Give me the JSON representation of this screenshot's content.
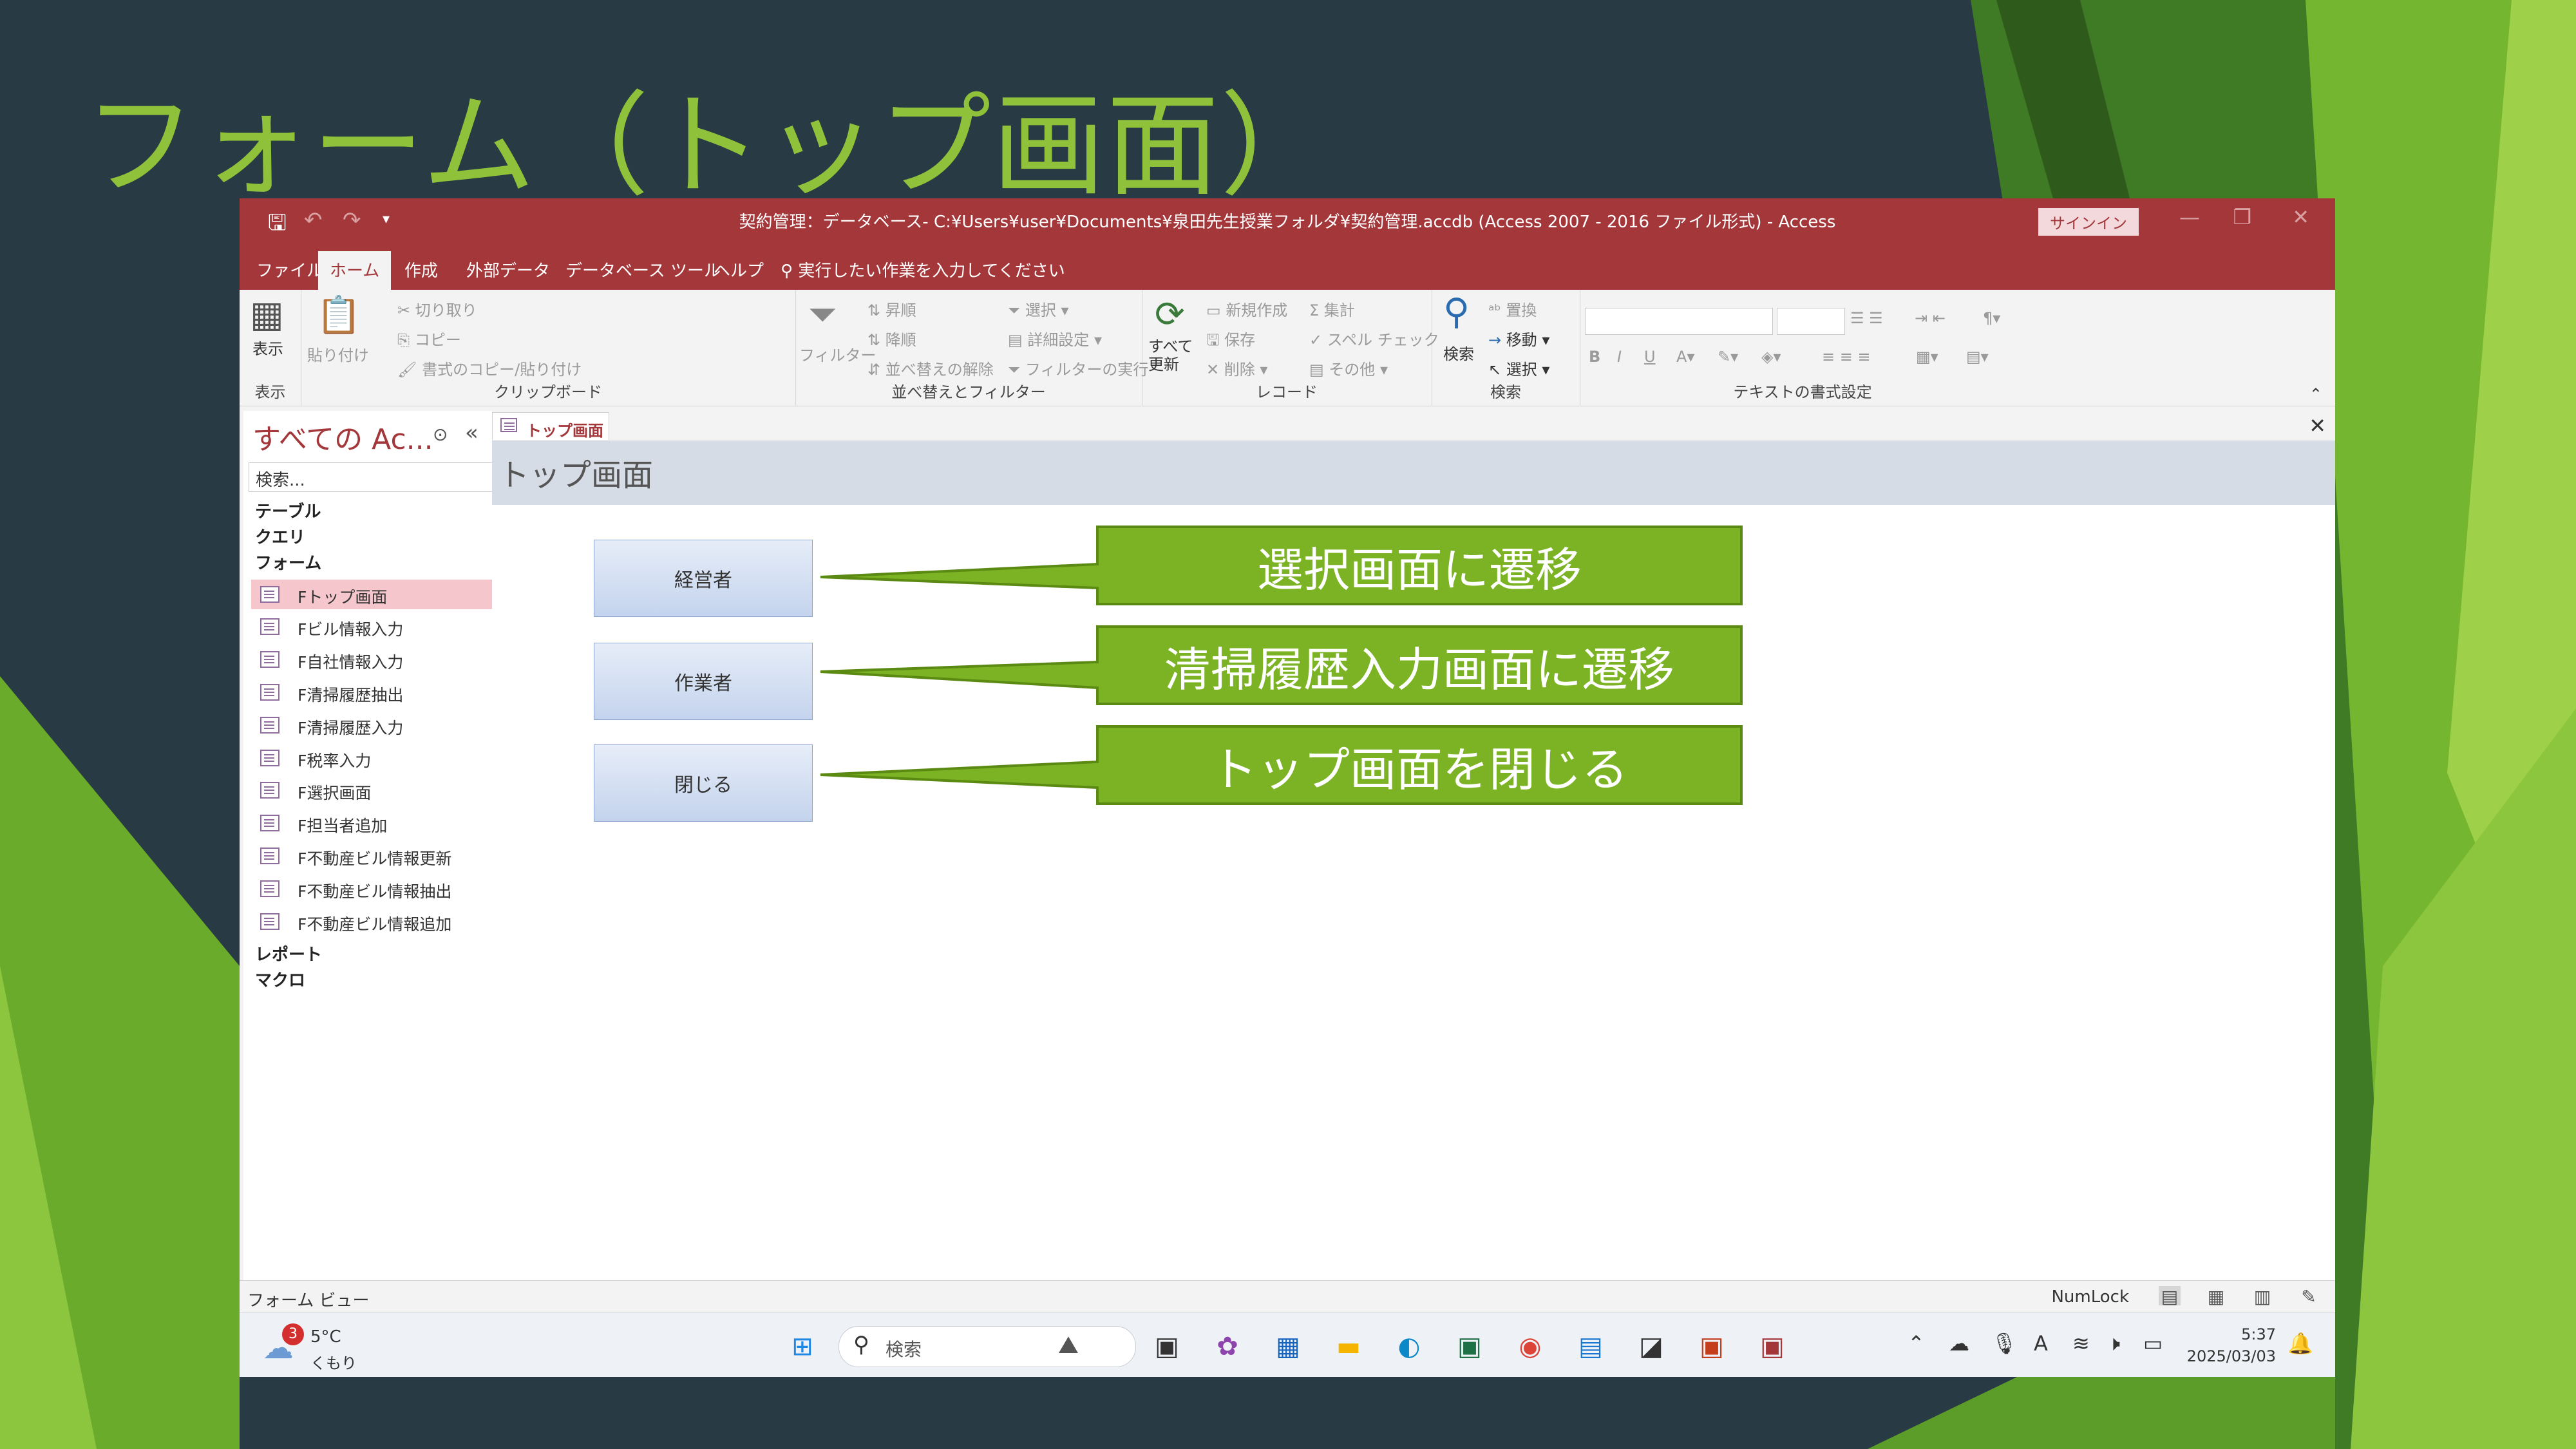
{
  "slide": {
    "title": "フォーム（トップ画面）"
  },
  "colors": {
    "accent_green": "#8fc23a",
    "access_red": "#a4373a",
    "callout_fill": "#7cb324",
    "callout_border": "#5b8a12"
  },
  "window": {
    "title": "契約管理：データベース- C:¥Users¥user¥Documents¥泉田先生授業フォルダ¥契約管理.accdb (Access 2007 - 2016 ファイル形式)  -  Access",
    "signin": "サインイン"
  },
  "ribbon": {
    "tabs": [
      "ファイル",
      "ホーム",
      "作成",
      "外部データ",
      "データベース ツール",
      "ヘルプ"
    ],
    "tell_me": "実行したい作業を入力してください",
    "groups": {
      "view": {
        "label": "表示",
        "button": "表示"
      },
      "clipboard": {
        "label": "クリップボード",
        "paste": "貼り付け",
        "cut": "切り取り",
        "copy": "コピー",
        "format_painter": "書式のコピー/貼り付け"
      },
      "sort_filter": {
        "label": "並べ替えとフィルター",
        "filter": "フィルター",
        "asc": "昇順",
        "desc": "降順",
        "clear_sort": "並べ替えの解除",
        "selection": "選択",
        "advanced": "詳細設定",
        "toggle_filter": "フィルターの実行"
      },
      "records": {
        "label": "レコード",
        "refresh": "すべて更新",
        "new": "新規作成",
        "save": "保存",
        "delete": "削除",
        "totals": "集計",
        "spelling": "スペル チェック",
        "more": "その他"
      },
      "find": {
        "label": "検索",
        "find": "検索",
        "replace": "置換",
        "goto": "移動",
        "select": "選択"
      },
      "text_format": {
        "label": "テキストの書式設定"
      }
    }
  },
  "nav": {
    "title": "すべての Ac...",
    "search_placeholder": "検索...",
    "categories": {
      "tables": "テーブル",
      "queries": "クエリ",
      "forms": "フォーム",
      "reports": "レポート",
      "macros": "マクロ"
    },
    "forms": [
      "Fトップ画面",
      "Fビル情報入力",
      "F自社情報入力",
      "F清掃履歴抽出",
      "F清掃履歴入力",
      "F税率入力",
      "F選択画面",
      "F担当者追加",
      "F不動産ビル情報更新",
      "F不動産ビル情報抽出",
      "F不動産ビル情報追加"
    ]
  },
  "document": {
    "tab": "トップ画面",
    "header": "トップ画面",
    "buttons": [
      "経営者",
      "作業者",
      "閉じる"
    ],
    "callouts": [
      "選択画面に遷移",
      "清掃履歴入力画面に遷移",
      "トップ画面を閉じる"
    ]
  },
  "status": {
    "view": "フォーム ビュー",
    "numlock": "NumLock"
  },
  "taskbar": {
    "weather": {
      "badge": "3",
      "temp": "5°C",
      "cond": "くもり"
    },
    "search": "検索",
    "time": "5:37",
    "date": "2025/03/03"
  }
}
